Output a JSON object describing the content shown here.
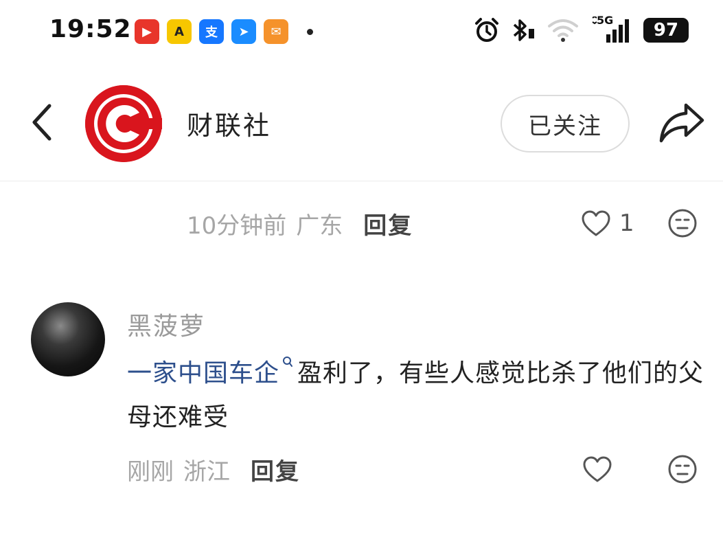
{
  "status_bar": {
    "time": "19:52",
    "network": "5G",
    "battery": "97",
    "app_icons": [
      {
        "name": "red-video-app-icon",
        "color": "#e8352b",
        "glyph": "▶"
      },
      {
        "name": "yellow-app-icon",
        "color": "#f7c700",
        "glyph": "A"
      },
      {
        "name": "alipay-app-icon",
        "color": "#1677ff",
        "glyph": "支"
      },
      {
        "name": "blue-bird-app-icon",
        "color": "#1a8cff",
        "glyph": "➤"
      },
      {
        "name": "orange-app-icon",
        "color": "#f5922b",
        "glyph": "✉"
      }
    ]
  },
  "header": {
    "account_name": "财联社",
    "follow_label": "已关注",
    "brand_color": "#d9151d"
  },
  "comments": [
    {
      "time": "10分钟前",
      "location": "广东",
      "reply_label": "回复",
      "like_count": "1"
    },
    {
      "username": "黑菠萝",
      "topic": "一家中国车企",
      "text": "盈利了，有些人感觉比杀了他们的父母还难受",
      "time": "刚刚",
      "location": "浙江",
      "reply_label": "回复",
      "like_count": ""
    }
  ],
  "colors": {
    "topic_link": "#2d4f8c",
    "meta_gray": "#a6a6a6"
  }
}
